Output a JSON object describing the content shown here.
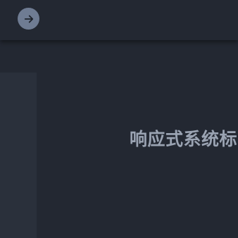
{
  "header": {
    "forward_icon": "arrow-right-icon"
  },
  "main": {
    "title": "响应式系统标"
  },
  "colors": {
    "background": "#232832",
    "topbar": "#232832",
    "side_panel": "#2a303b",
    "button": "#6f7c93",
    "title_text": "#9aa3b2"
  }
}
